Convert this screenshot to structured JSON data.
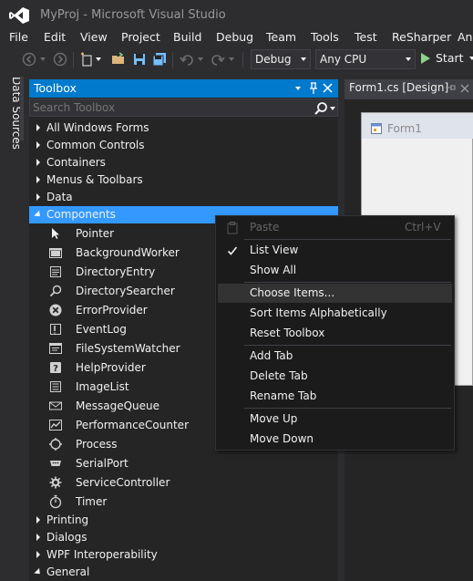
{
  "window": {
    "title": "MyProj - Microsoft Visual Studio",
    "logo_icon": "visual-studio-logo"
  },
  "menubar": {
    "items": [
      "File",
      "Edit",
      "View",
      "Project",
      "Build",
      "Debug",
      "Team",
      "Tools",
      "Test",
      "ReSharper",
      "An"
    ]
  },
  "toolbar": {
    "icons": [
      "back-arrow-icon",
      "forward-arrow-icon",
      "new-project-icon",
      "open-folder-icon",
      "save-icon",
      "save-all-icon",
      "undo-icon",
      "redo-icon"
    ],
    "configuration": "Debug",
    "platform": "Any CPU",
    "start_label": "Start"
  },
  "side_tabs": {
    "data_sources": "Data Sources"
  },
  "toolbox": {
    "title": "Toolbox",
    "search_placeholder": "Search Toolbox",
    "categories_top": [
      "All Windows Forms",
      "Common Controls",
      "Containers",
      "Menus & Toolbars",
      "Data"
    ],
    "expanded_category": "Components",
    "components": [
      {
        "label": "Pointer",
        "icon": "pointer-icon"
      },
      {
        "label": "BackgroundWorker",
        "icon": "background-worker-icon"
      },
      {
        "label": "DirectoryEntry",
        "icon": "directory-entry-icon"
      },
      {
        "label": "DirectorySearcher",
        "icon": "directory-searcher-icon"
      },
      {
        "label": "ErrorProvider",
        "icon": "error-provider-icon"
      },
      {
        "label": "EventLog",
        "icon": "event-log-icon"
      },
      {
        "label": "FileSystemWatcher",
        "icon": "file-system-watcher-icon"
      },
      {
        "label": "HelpProvider",
        "icon": "help-provider-icon"
      },
      {
        "label": "ImageList",
        "icon": "image-list-icon"
      },
      {
        "label": "MessageQueue",
        "icon": "message-queue-icon"
      },
      {
        "label": "PerformanceCounter",
        "icon": "performance-counter-icon"
      },
      {
        "label": "Process",
        "icon": "process-icon"
      },
      {
        "label": "SerialPort",
        "icon": "serial-port-icon"
      },
      {
        "label": "ServiceController",
        "icon": "service-controller-icon"
      },
      {
        "label": "Timer",
        "icon": "timer-icon"
      }
    ],
    "categories_bottom": [
      "Printing",
      "Dialogs",
      "WPF Interoperability",
      "General"
    ]
  },
  "designer": {
    "tab_label": "Form1.cs [Design]",
    "form_title": "Form1"
  },
  "context_menu": {
    "paste": {
      "label": "Paste",
      "shortcut": "Ctrl+V",
      "enabled": false
    },
    "list_view": {
      "label": "List View",
      "checked": true
    },
    "show_all": {
      "label": "Show All"
    },
    "choose_items": {
      "label": "Choose Items..."
    },
    "sort": {
      "label": "Sort Items Alphabetically"
    },
    "reset": {
      "label": "Reset Toolbox"
    },
    "add_tab": {
      "label": "Add Tab"
    },
    "delete_tab": {
      "label": "Delete Tab"
    },
    "rename_tab": {
      "label": "Rename Tab"
    },
    "move_up": {
      "label": "Move Up"
    },
    "move_down": {
      "label": "Move Down"
    }
  },
  "colors": {
    "accent": "#007acc",
    "selection": "#3399ff",
    "background": "#2d2d30",
    "panel": "#252526",
    "menu_background": "#1b1b1c"
  }
}
